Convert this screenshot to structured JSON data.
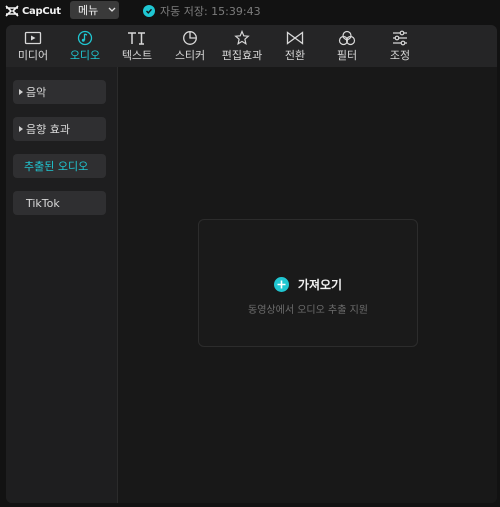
{
  "app": {
    "logo_text": "CapCut"
  },
  "topbar": {
    "menu_label": "메뉴",
    "autosave_text": "자동 저장: 15:39:43"
  },
  "tabs": [
    {
      "label": "미디어",
      "icon": "media-icon",
      "active": false
    },
    {
      "label": "오디오",
      "icon": "audio-icon",
      "active": true
    },
    {
      "label": "텍스트",
      "icon": "text-icon",
      "active": false
    },
    {
      "label": "스티커",
      "icon": "sticker-icon",
      "active": false
    },
    {
      "label": "편집효과",
      "icon": "effects-icon",
      "active": false
    },
    {
      "label": "전환",
      "icon": "transition-icon",
      "active": false
    },
    {
      "label": "필터",
      "icon": "filter-icon",
      "active": false
    },
    {
      "label": "조정",
      "icon": "adjust-icon",
      "active": false
    }
  ],
  "sidebar": {
    "items": [
      {
        "label": "음악",
        "expandable": true,
        "active": false
      },
      {
        "label": "음향 효과",
        "expandable": true,
        "active": false
      },
      {
        "label": "추출된 오디오",
        "expandable": false,
        "active": true
      },
      {
        "label": "TikTok",
        "expandable": false,
        "active": false
      }
    ]
  },
  "content": {
    "import_label": "가져오기",
    "import_sub": "동영상에서 오디오 추출 지원"
  },
  "colors": {
    "accent": "#20c6d1",
    "panel": "#1e1e1f",
    "background": "#121212"
  }
}
